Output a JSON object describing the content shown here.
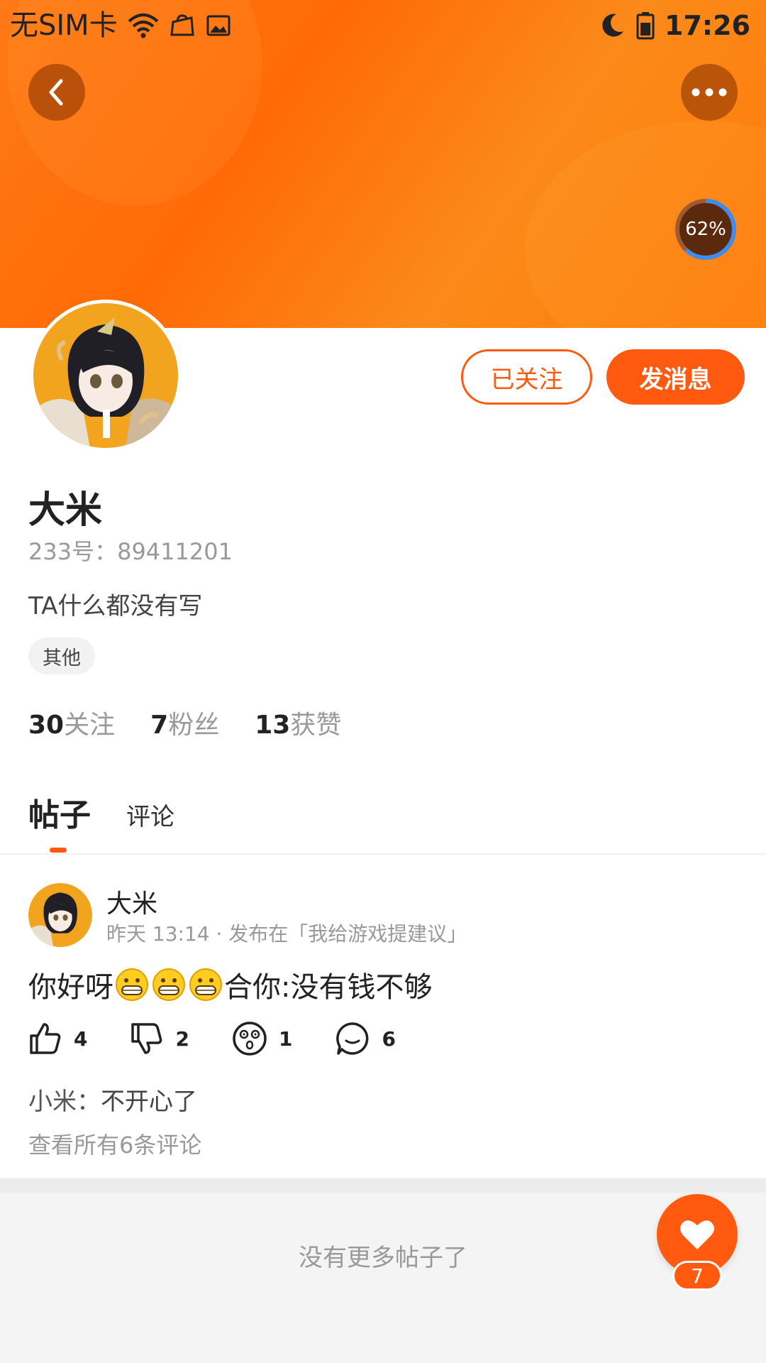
{
  "status_bar": {
    "sim": "无SIM卡",
    "time": "17:26"
  },
  "header": {
    "progress_percent": "62%",
    "progress_value": 0.62,
    "back_icon": "chevron-left-icon",
    "more_icon": "more-horizontal-icon"
  },
  "profile": {
    "followed_label": "已关注",
    "message_label": "发消息",
    "name": "大米",
    "uid": "233号：89411201",
    "bio": "TA什么都没有写",
    "tag": "其他",
    "stats": [
      {
        "num": "30",
        "label": "关注"
      },
      {
        "num": "7",
        "label": "粉丝"
      },
      {
        "num": "13",
        "label": "获赞"
      }
    ]
  },
  "tabs": [
    {
      "label": "帖子",
      "active": true
    },
    {
      "label": "评论",
      "active": false
    }
  ],
  "post": {
    "author": "大米",
    "meta": "昨天 13:14 · 发布在「我给游戏提建议」",
    "content_prefix": "你好呀",
    "content_suffix": "合你:没有钱不够",
    "emoji_count": 3,
    "likes": "4",
    "dislikes": "2",
    "reactions": "1",
    "comments": "6",
    "top_comment_user": "小米：",
    "top_comment_text": "不开心了",
    "view_all": "查看所有6条评论"
  },
  "footer": {
    "no_more": "没有更多帖子了",
    "fab_badge": "7"
  },
  "colors": {
    "accent": "#ff5a10",
    "header": "#ff7a10"
  }
}
